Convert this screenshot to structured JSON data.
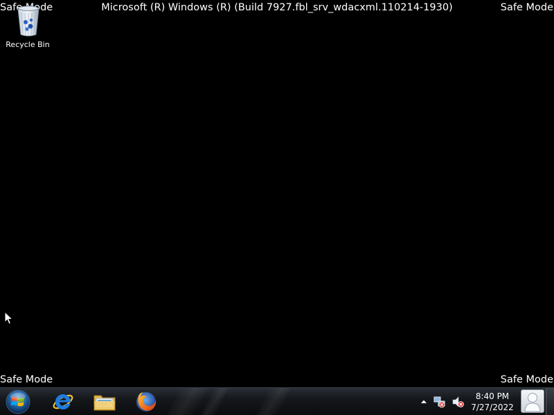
{
  "overlay": {
    "safe_mode_top_left": "Safe Mode",
    "safe_mode_top_right": "Safe Mode",
    "safe_mode_bottom_left": "Safe Mode",
    "safe_mode_bottom_right": "Safe Mode",
    "build_title": "Microsoft (R) Windows (R) (Build 7927.fbl_srv_wdacxml.110214-1930)"
  },
  "desktop": {
    "background_color": "#000000",
    "icons": [
      {
        "label": "Recycle Bin",
        "icon": "recycle-bin-icon"
      }
    ]
  },
  "taskbar": {
    "start_icon": "windows-start-orb-icon",
    "pinned": [
      {
        "name": "Internet Explorer",
        "icon": "internet-explorer-icon"
      },
      {
        "name": "Windows Explorer",
        "icon": "folder-explorer-icon"
      },
      {
        "name": "Firefox",
        "icon": "firefox-icon"
      }
    ],
    "tray": {
      "show_hidden_icon": "up-arrow-icon",
      "network_icon": "network-icon",
      "volume_icon": "volume-muted-icon",
      "time": "8:40 PM",
      "date": "7/27/2022",
      "user_icon": "user-avatar-icon"
    }
  }
}
